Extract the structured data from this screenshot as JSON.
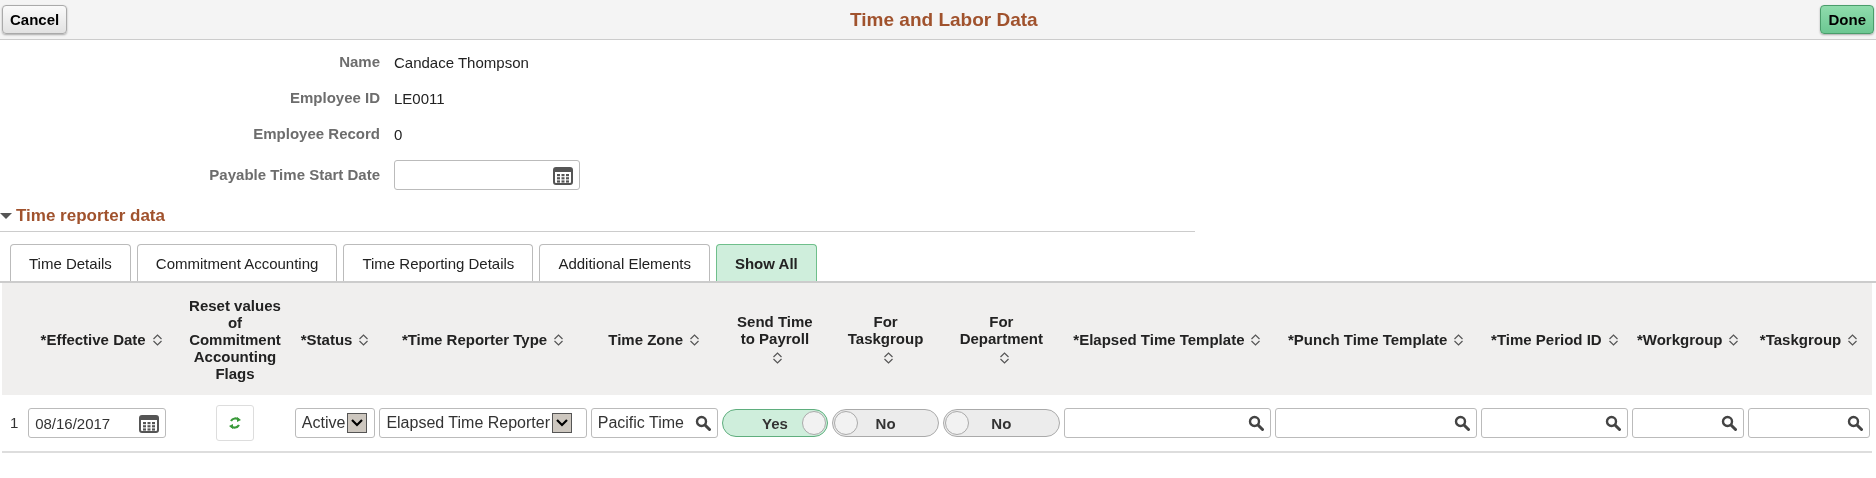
{
  "header": {
    "cancel": "Cancel",
    "title": "Time and Labor Data",
    "done": "Done"
  },
  "fields": [
    {
      "label": "Name",
      "kind": "text",
      "value": "Candace Thompson"
    },
    {
      "label": "Employee ID",
      "kind": "text",
      "value": "LE0011"
    },
    {
      "label": "Employee Record",
      "kind": "text",
      "value": "0"
    },
    {
      "label": "Payable Time Start Date",
      "kind": "date"
    }
  ],
  "section": {
    "title": "Time reporter data",
    "expanded": true
  },
  "tabs": [
    {
      "label": "Time Details",
      "selected": false
    },
    {
      "label": "Commitment Accounting",
      "selected": false
    },
    {
      "label": "Time Reporting Details",
      "selected": false
    },
    {
      "label": "Additional Elements",
      "selected": false
    },
    {
      "label": "Show All",
      "selected": true
    }
  ],
  "grid": {
    "columns": [
      {
        "label": "*Effective Date",
        "sortable": true
      },
      {
        "label": "Reset values of Commitment Accounting Flags",
        "sortable": false
      },
      {
        "label": "*Status",
        "sortable": true
      },
      {
        "label": "*Time Reporter Type",
        "sortable": true
      },
      {
        "label": "Time Zone",
        "sortable": true
      },
      {
        "label": "Send Time to Payroll",
        "sortable": true
      },
      {
        "label": "For Taskgroup",
        "sortable": true
      },
      {
        "label": "For Department",
        "sortable": true
      },
      {
        "label": "*Elapsed Time Template",
        "sortable": true
      },
      {
        "label": "*Punch Time Template",
        "sortable": true
      },
      {
        "label": "*Time Period ID",
        "sortable": true
      },
      {
        "label": "*Workgroup",
        "sortable": true
      },
      {
        "label": "*Taskgroup",
        "sortable": true
      }
    ],
    "rows": [
      {
        "number": "1",
        "cells": [
          {
            "kind": "date",
            "value": "08/16/2017"
          },
          {
            "kind": "reset"
          },
          {
            "kind": "select",
            "value": "Active"
          },
          {
            "kind": "select",
            "value": "Elapsed Time Reporter"
          },
          {
            "kind": "prompt",
            "value": "Pacific Time"
          },
          {
            "kind": "toggle",
            "on": true,
            "value": "Yes"
          },
          {
            "kind": "toggle",
            "on": false,
            "value": "No"
          },
          {
            "kind": "toggle",
            "on": false,
            "value": "No"
          },
          {
            "kind": "prompt"
          },
          {
            "kind": "prompt"
          },
          {
            "kind": "prompt"
          },
          {
            "kind": "prompt"
          },
          {
            "kind": "prompt"
          }
        ]
      }
    ]
  }
}
